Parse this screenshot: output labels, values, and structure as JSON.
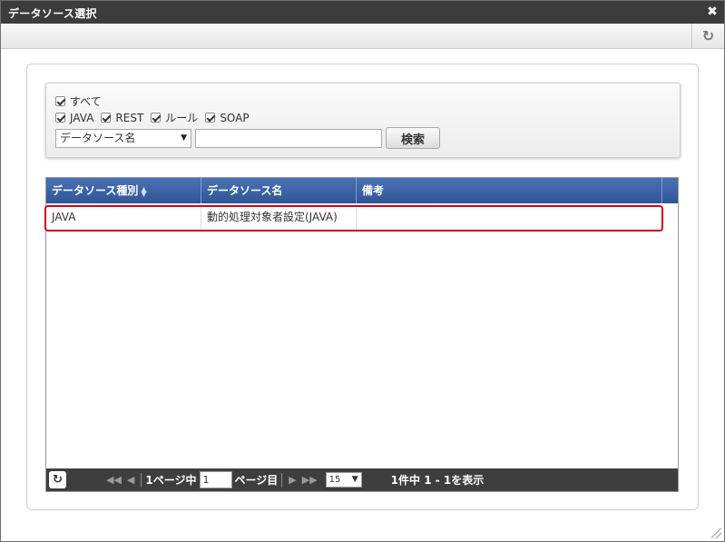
{
  "window": {
    "title": "データソース選択",
    "close_icon": "close-icon",
    "refresh_icon": "refresh-icon"
  },
  "search": {
    "checkboxes_row1": [
      {
        "label": "すべて",
        "checked": true
      }
    ],
    "checkboxes_row2": [
      {
        "label": "JAVA",
        "checked": true
      },
      {
        "label": "REST",
        "checked": true
      },
      {
        "label": "ルール",
        "checked": true
      },
      {
        "label": "SOAP",
        "checked": true
      }
    ],
    "field_select": "データソース名",
    "keyword_value": "",
    "search_button": "検索"
  },
  "grid": {
    "columns": [
      "データソース種別",
      "データソース名",
      "備考"
    ],
    "rows": [
      {
        "type": "JAVA",
        "name": "動的処理対象者設定(JAVA)",
        "note": ""
      }
    ],
    "selected_row_color": "#d0021b",
    "header_color": "#2f5597"
  },
  "pager": {
    "first_icon": "first-page-icon",
    "prev_icon": "prev-page-icon",
    "page_prefix": "1ページ中",
    "page_value": "1",
    "page_suffix": "ページ目",
    "next_icon": "next-page-icon",
    "last_icon": "last-page-icon",
    "page_size": "15",
    "info": "1件中 1 - 1を表示"
  }
}
